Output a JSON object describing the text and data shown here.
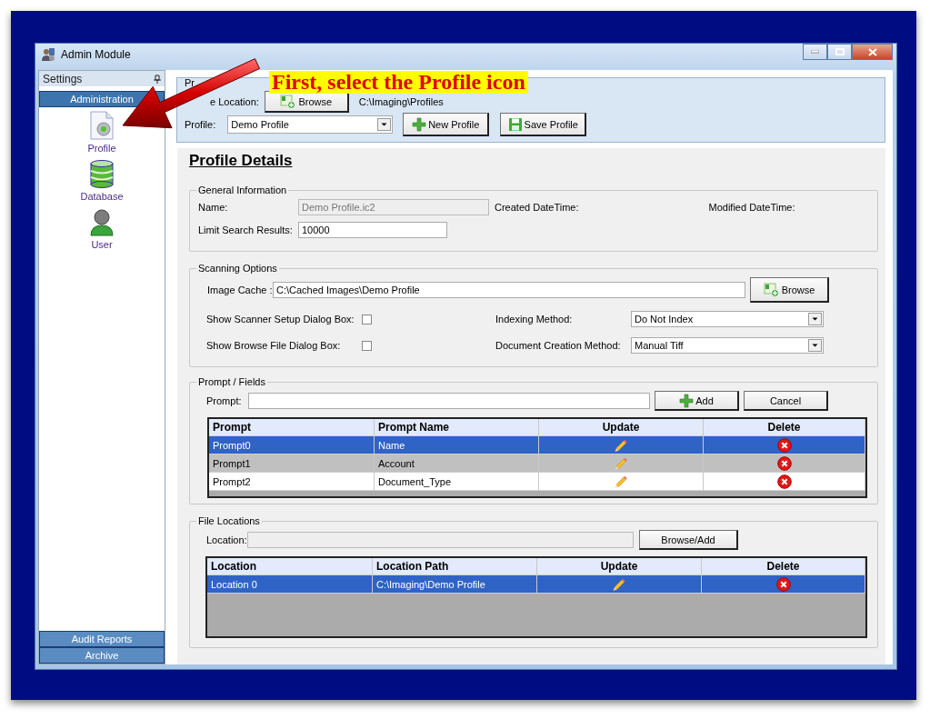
{
  "window": {
    "title": "Admin Module"
  },
  "sidebar": {
    "header": "Settings",
    "sections": [
      {
        "label": "Administration",
        "selected": true
      }
    ],
    "items": [
      {
        "label": "Profile"
      },
      {
        "label": "Database"
      },
      {
        "label": "User"
      }
    ],
    "bottom_sections": [
      {
        "label": "Audit Reports",
        "selected": false
      },
      {
        "label": "Archive",
        "selected": false
      }
    ]
  },
  "toolbar": {
    "group_title": "Pr",
    "location_label": "e Location:",
    "browse_button": "Browse",
    "location_path": "C:\\Imaging\\Profiles",
    "profile_label": "Profile:",
    "profile_value": "Demo Profile",
    "new_button": "New Profile",
    "save_button": "Save Profile"
  },
  "details": {
    "heading": "Profile Details",
    "general": {
      "title": "General Information",
      "name_label": "Name:",
      "name_value": "Demo Profile.ic2",
      "name_disabled": true,
      "created_label": "Created DateTime:",
      "modified_label": "Modified DateTime:",
      "limit_label": "Limit Search Results:",
      "limit_value": "10000"
    },
    "scanning": {
      "title": "Scanning Options",
      "image_cache_label": "Image Cache :",
      "image_cache_value": "C:\\Cached Images\\Demo Profile",
      "browse_button": "Browse",
      "checkboxes": [
        {
          "label": "Show Scanner Setup Dialog Box:",
          "checked": false
        },
        {
          "label": "Show Browse File Dialog Box:",
          "checked": false
        }
      ],
      "dropdowns": [
        {
          "label": "Indexing Method:",
          "value": "Do Not Index"
        },
        {
          "label": "Document Creation Method:",
          "value": "Manual Tiff"
        }
      ]
    },
    "prompts": {
      "title": "Prompt / Fields",
      "prompt_label": "Prompt:",
      "add_button": "Add",
      "cancel_button": "Cancel",
      "table": {
        "columns": [
          "Prompt",
          "Prompt Name",
          "Update",
          "Delete"
        ],
        "rows": [
          {
            "cells": [
              "Prompt0",
              "Name"
            ],
            "selected": true
          },
          {
            "cells": [
              "Prompt1",
              "Account"
            ],
            "selected": false
          },
          {
            "cells": [
              "Prompt2",
              "Document_Type"
            ],
            "selected": false
          }
        ]
      }
    },
    "file_locations": {
      "title": "File Locations",
      "location_label": "Location:",
      "location_disabled": true,
      "browse_add_button": "Browse/Add",
      "table": {
        "columns": [
          "Location",
          "Location Path",
          "Update",
          "Delete"
        ],
        "rows": [
          {
            "cells": [
              "Location 0",
              "C:\\Imaging\\Demo Profile"
            ],
            "selected": true
          }
        ]
      }
    }
  },
  "annotation": {
    "text": "First, select the Profile icon"
  }
}
